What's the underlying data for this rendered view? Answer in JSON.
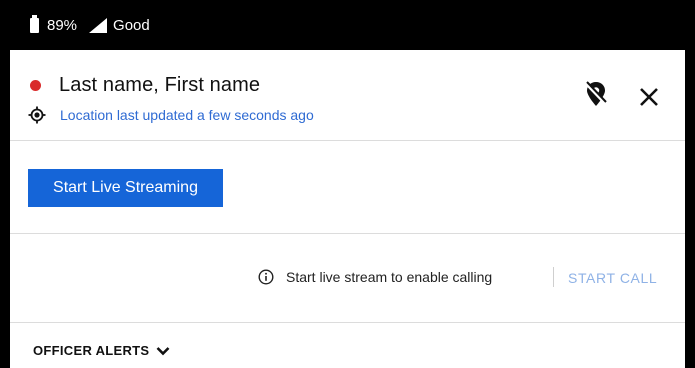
{
  "status_bar": {
    "battery": "89%",
    "signal": "Good"
  },
  "header": {
    "status_color": "#d92b2b",
    "name": "Last name, First name",
    "location_text": "Location last updated a few seconds ago",
    "icons": [
      "location-target-icon",
      "pin-off-icon",
      "close-icon"
    ]
  },
  "stream": {
    "button_label": "Start Live Streaming",
    "button_color": "#1565d8"
  },
  "call": {
    "info_text": "Start live stream to enable calling",
    "start_call_label": "START CALL",
    "start_call_color": "#8fb2e6"
  },
  "alerts": {
    "label": "OFFICER ALERTS"
  }
}
